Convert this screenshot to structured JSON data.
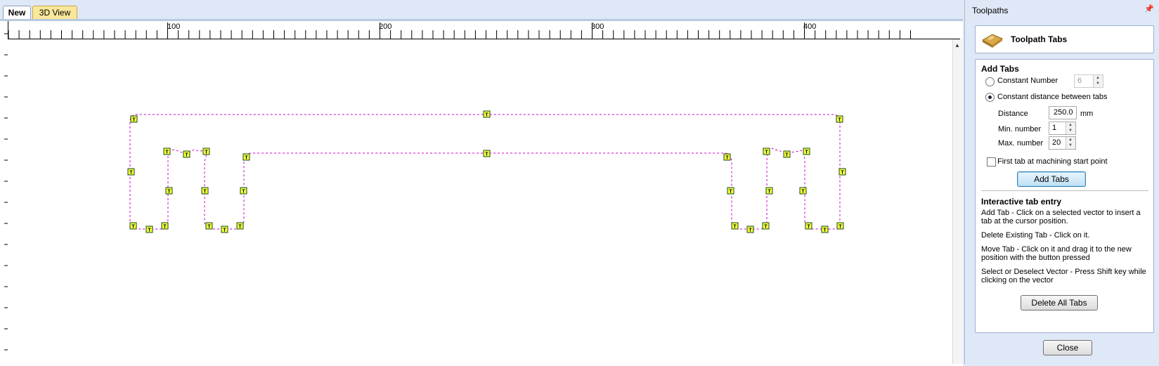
{
  "view_tabs": {
    "new": "New",
    "three_d": "3D View"
  },
  "ruler": {
    "labels": [
      "100",
      "200",
      "300",
      "400"
    ]
  },
  "panel": {
    "title": "Toolpaths",
    "header_title": "Toolpath Tabs",
    "add_tabs_heading": "Add Tabs",
    "constant_number_label": "Constant Number",
    "constant_number_value": "6",
    "constant_distance_label": "Constant distance between tabs",
    "distance_label": "Distance",
    "distance_value": "250.0",
    "distance_unit": "mm",
    "min_number_label": "Min. number",
    "min_number_value": "1",
    "max_number_label": "Max. number",
    "max_number_value": "20",
    "first_tab_label": "First tab at machining start point",
    "add_tabs_button": "Add Tabs",
    "interactive_heading": "Interactive tab entry",
    "help_add": "Add Tab - Click on a selected vector to insert a tab at the cursor position.",
    "help_delete": "Delete Existing Tab - Click on it.",
    "help_move": "Move Tab - Click on it and drag it to the new position with the button pressed",
    "help_select": "Select or Deselect Vector - Press Shift key while clicking on the vector",
    "delete_all_button": "Delete All Tabs",
    "close_button": "Close"
  },
  "canvas": {
    "tab_marker_text": "T"
  },
  "colors": {
    "vector": "#cc00cc",
    "tab_fill": "#f0ff3c"
  }
}
